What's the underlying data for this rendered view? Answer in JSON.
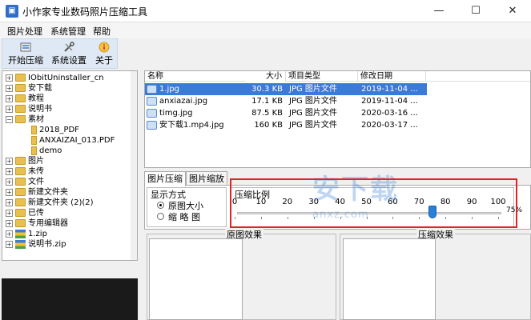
{
  "window": {
    "title": "小作家专业数码照片压缩工具",
    "minimize": "—",
    "maximize": "☐",
    "close": "✕"
  },
  "menu": [
    "图片处理",
    "系统管理",
    "帮助"
  ],
  "toolbar": {
    "compress_label": "开始压缩",
    "settings_label": "系统设置",
    "about_label": "关于"
  },
  "tree": [
    {
      "label": "IObitUninstaller_cn",
      "expander": "+"
    },
    {
      "label": "安下载",
      "expander": "+"
    },
    {
      "label": "教程",
      "expander": "+"
    },
    {
      "label": "说明书",
      "expander": "+"
    },
    {
      "label": "素材",
      "expander": "−"
    },
    {
      "label": "2018_PDF",
      "sub": true
    },
    {
      "label": "ANXAIZAI_013.PDF",
      "sub": true
    },
    {
      "label": "demo",
      "sub": true
    },
    {
      "label": "图片",
      "expander": "+"
    },
    {
      "label": "未传",
      "expander": "+"
    },
    {
      "label": "文件",
      "expander": "+"
    },
    {
      "label": "新建文件夹",
      "expander": "+"
    },
    {
      "label": "新建文件夹 (2)(2)",
      "expander": "+"
    },
    {
      "label": "已传",
      "expander": "+"
    },
    {
      "label": "专用编辑器",
      "expander": "+"
    },
    {
      "label": "1.zip",
      "expander": "+",
      "zip": true
    },
    {
      "label": "说明书.zip",
      "expander": "+",
      "zip": true
    }
  ],
  "filelist": {
    "headers": {
      "name": "名称",
      "size": "大小",
      "type": "项目类型",
      "date": "修改日期"
    },
    "rows": [
      {
        "name": "1.jpg",
        "size": "30.3 KB",
        "type": "JPG 图片文件",
        "date": "2019-11-04 ...",
        "selected": true
      },
      {
        "name": "anxiazai.jpg",
        "size": "17.1 KB",
        "type": "JPG 图片文件",
        "date": "2019-11-04 ..."
      },
      {
        "name": "timg.jpg",
        "size": "87.5 KB",
        "type": "JPG 图片文件",
        "date": "2020-03-16 ..."
      },
      {
        "name": "安下载1.mp4.jpg",
        "size": "160 KB",
        "type": "JPG 图片文件",
        "date": "2020-03-17 ..."
      }
    ]
  },
  "tabs": {
    "compress": "图片压缩",
    "zoom": "图片缩放"
  },
  "display": {
    "legend": "显示方式",
    "option1": "原图大小",
    "option2": "缩 略 图"
  },
  "ratio": {
    "legend": "压缩比例",
    "ticks": [
      "0",
      "10",
      "20",
      "30",
      "40",
      "50",
      "60",
      "70",
      "80",
      "90",
      "100"
    ],
    "value": 75,
    "percent_label": "75%"
  },
  "frames": {
    "original": "原图效果",
    "compressed": "压缩效果"
  },
  "watermark": {
    "line1": "安下载",
    "line2": "anxz.com"
  }
}
